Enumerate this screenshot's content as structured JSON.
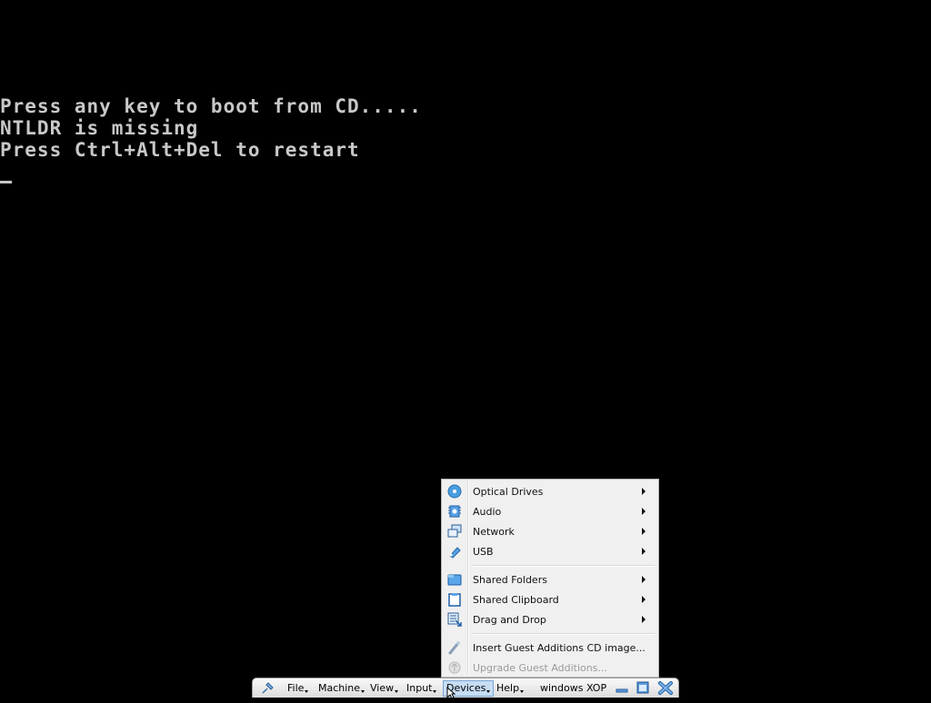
{
  "console": {
    "lines": [
      "Press any key to boot from CD.....",
      "NTLDR is missing",
      "Press Ctrl+Alt+Del to restart"
    ]
  },
  "devices_menu": {
    "items": [
      {
        "label": "Optical Drives",
        "icon": "optical-disc-icon",
        "submenu": true
      },
      {
        "label": "Audio",
        "icon": "audio-chip-icon",
        "submenu": true
      },
      {
        "label": "Network",
        "icon": "network-icon",
        "submenu": true
      },
      {
        "label": "USB",
        "icon": "usb-icon",
        "submenu": true
      },
      {
        "label": "Shared Folders",
        "icon": "folder-icon",
        "submenu": true
      },
      {
        "label": "Shared Clipboard",
        "icon": "clipboard-icon",
        "submenu": true
      },
      {
        "label": "Drag and Drop",
        "icon": "drag-drop-icon",
        "submenu": true
      },
      {
        "label": "Insert Guest Additions CD image...",
        "icon": "guest-additions-icon",
        "submenu": false
      },
      {
        "label": "Upgrade Guest Additions...",
        "icon": "upgrade-icon",
        "submenu": false,
        "disabled": true
      }
    ]
  },
  "toolbar": {
    "menus": [
      "File",
      "Machine",
      "View",
      "Input",
      "Devices",
      "Help"
    ],
    "active_menu": "Devices",
    "vm_name": "windows XOP",
    "icons": [
      "pin-icon",
      "minimize-icon",
      "restore-icon",
      "close-icon"
    ]
  },
  "colors": {
    "console_text": "#c8c8c8",
    "menu_bg": "#f0f0f0",
    "highlight": "#c7ddf3",
    "close_blue": "#2a6fd6"
  }
}
